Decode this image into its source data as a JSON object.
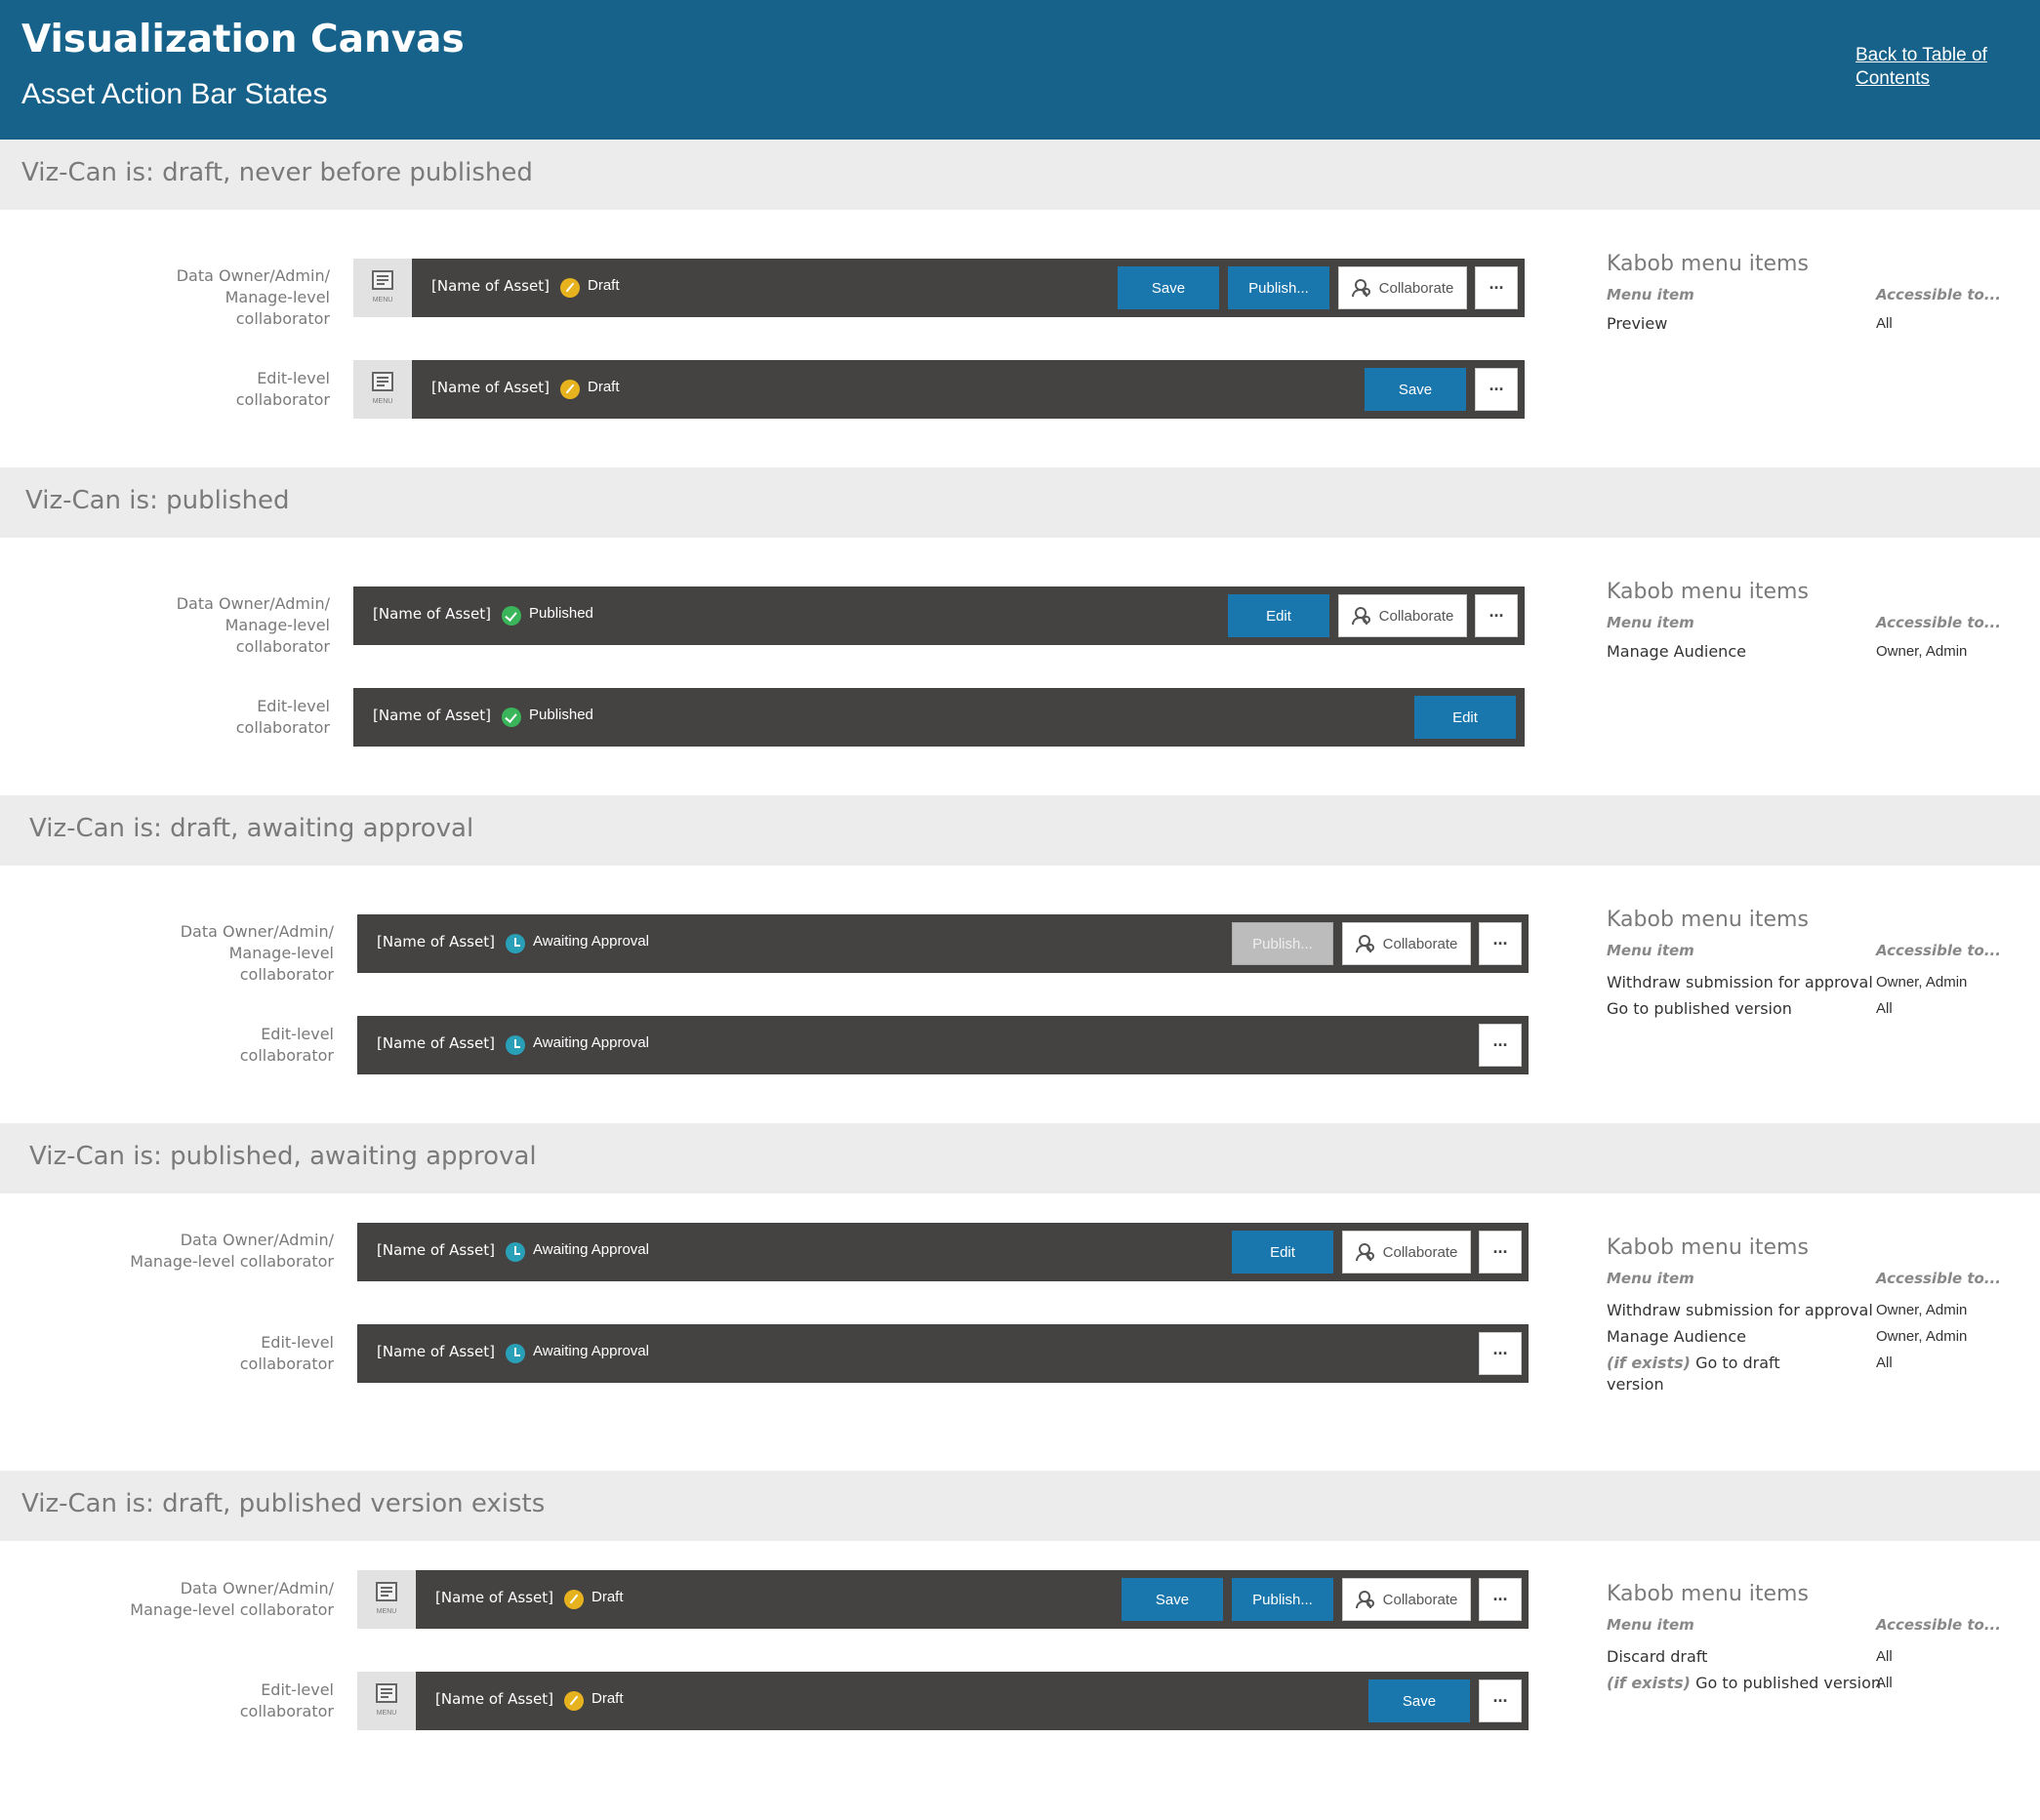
{
  "header": {
    "title": "Visualization Canvas",
    "subtitle": "Asset Action Bar States",
    "back_link": "Back to Table of Contents"
  },
  "common": {
    "asset_name": "[Name of Asset]",
    "menu_label": "MENU",
    "kabob_glyph": "···",
    "kabob_title": "Kabob menu items",
    "col_menu_item": "Menu item",
    "col_accessible": "Accessible to...",
    "role_owner_3line": "Data Owner/Admin/\nManage-level\ncollaborator",
    "role_owner_2line": "Data Owner/Admin/\nManage-level collaborator",
    "role_edit": "Edit-level\ncollaborator"
  },
  "status": {
    "draft": "Draft",
    "published": "Published",
    "awaiting": "Awaiting Approval"
  },
  "buttons": {
    "save": "Save",
    "publish": "Publish...",
    "collaborate": "Collaborate",
    "edit": "Edit"
  },
  "sections": [
    {
      "title": "Viz-Can is: draft, never before published",
      "kabob_items": [
        {
          "item": "Preview",
          "access": "All"
        }
      ]
    },
    {
      "title": "Viz-Can is: published",
      "kabob_items": [
        {
          "item": "Manage Audience",
          "access": "Owner, Admin"
        }
      ]
    },
    {
      "title": "Viz-Can is: draft, awaiting approval",
      "kabob_items": [
        {
          "item": "Withdraw submission for approval",
          "access": "Owner, Admin"
        },
        {
          "item": "Go to published version",
          "access": "All"
        }
      ]
    },
    {
      "title": "Viz-Can is: published, awaiting approval",
      "kabob_items": [
        {
          "item": "Withdraw submission for approval",
          "access": "Owner, Admin"
        },
        {
          "item": "Manage Audience",
          "access": "Owner, Admin"
        },
        {
          "prefix": "(if exists)",
          "item": " Go to draft version",
          "access": "All"
        }
      ]
    },
    {
      "title": "Viz-Can is: draft, published version exists",
      "kabob_items": [
        {
          "item": "Discard draft",
          "access": "All"
        },
        {
          "prefix": "(if exists)",
          "item": " Go to published version",
          "access": "All"
        }
      ]
    }
  ],
  "colors": {
    "header_bg": "#17628a",
    "band_bg": "#ececec",
    "bar_bg": "#454242",
    "primary_button": "#1a77ad",
    "draft_icon": "#e6b21e",
    "published_icon": "#3ab55a",
    "awaiting_icon": "#29a0b8"
  }
}
